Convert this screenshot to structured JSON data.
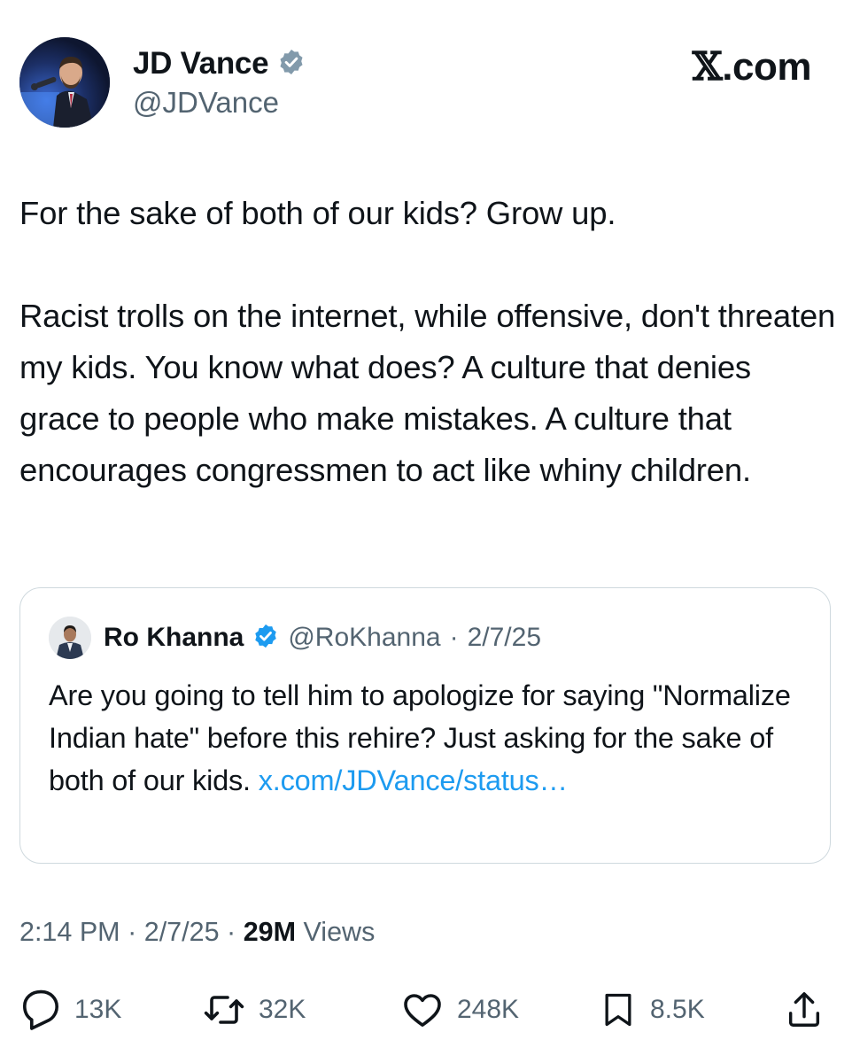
{
  "author": {
    "display_name": "JD Vance",
    "handle": "@JDVance",
    "verified": true,
    "avatar": "profile-photo"
  },
  "brand": {
    "x_mark": "𝕏",
    "domain": ".com"
  },
  "tweet": {
    "paragraphs": [
      "For the sake of both of our kids? Grow up.",
      "Racist trolls on the internet, while offensive, don't threaten my kids. You know what does? A culture that denies grace to people who make mistakes. A culture that encourages congressmen to act like whiny children."
    ]
  },
  "quoted_tweet": {
    "display_name": "Ro Khanna",
    "handle": "@RoKhanna",
    "separator": "·",
    "date": "2/7/25",
    "verified": true,
    "text": "Are you going to tell him to apologize for saying \"Normalize Indian hate\" before this rehire? Just asking for the sake of both of our kids. ",
    "link_text": "x.com/​JDVance/status…"
  },
  "meta": {
    "time": "2:14 PM",
    "separator": "·",
    "date": "2/7/25",
    "views_count": "29M",
    "views_label": "Views"
  },
  "actions": {
    "replies": "13K",
    "reposts": "32K",
    "likes": "248K",
    "bookmarks": "8.5K"
  },
  "colors": {
    "text": "#0f1419",
    "secondary": "#536471",
    "link": "#1d9bf0",
    "border": "#cfd9de",
    "verified": "#829aab"
  },
  "icons": [
    "verified-badge-icon",
    "reply-icon",
    "repost-icon",
    "like-icon",
    "bookmark-icon",
    "share-icon"
  ]
}
